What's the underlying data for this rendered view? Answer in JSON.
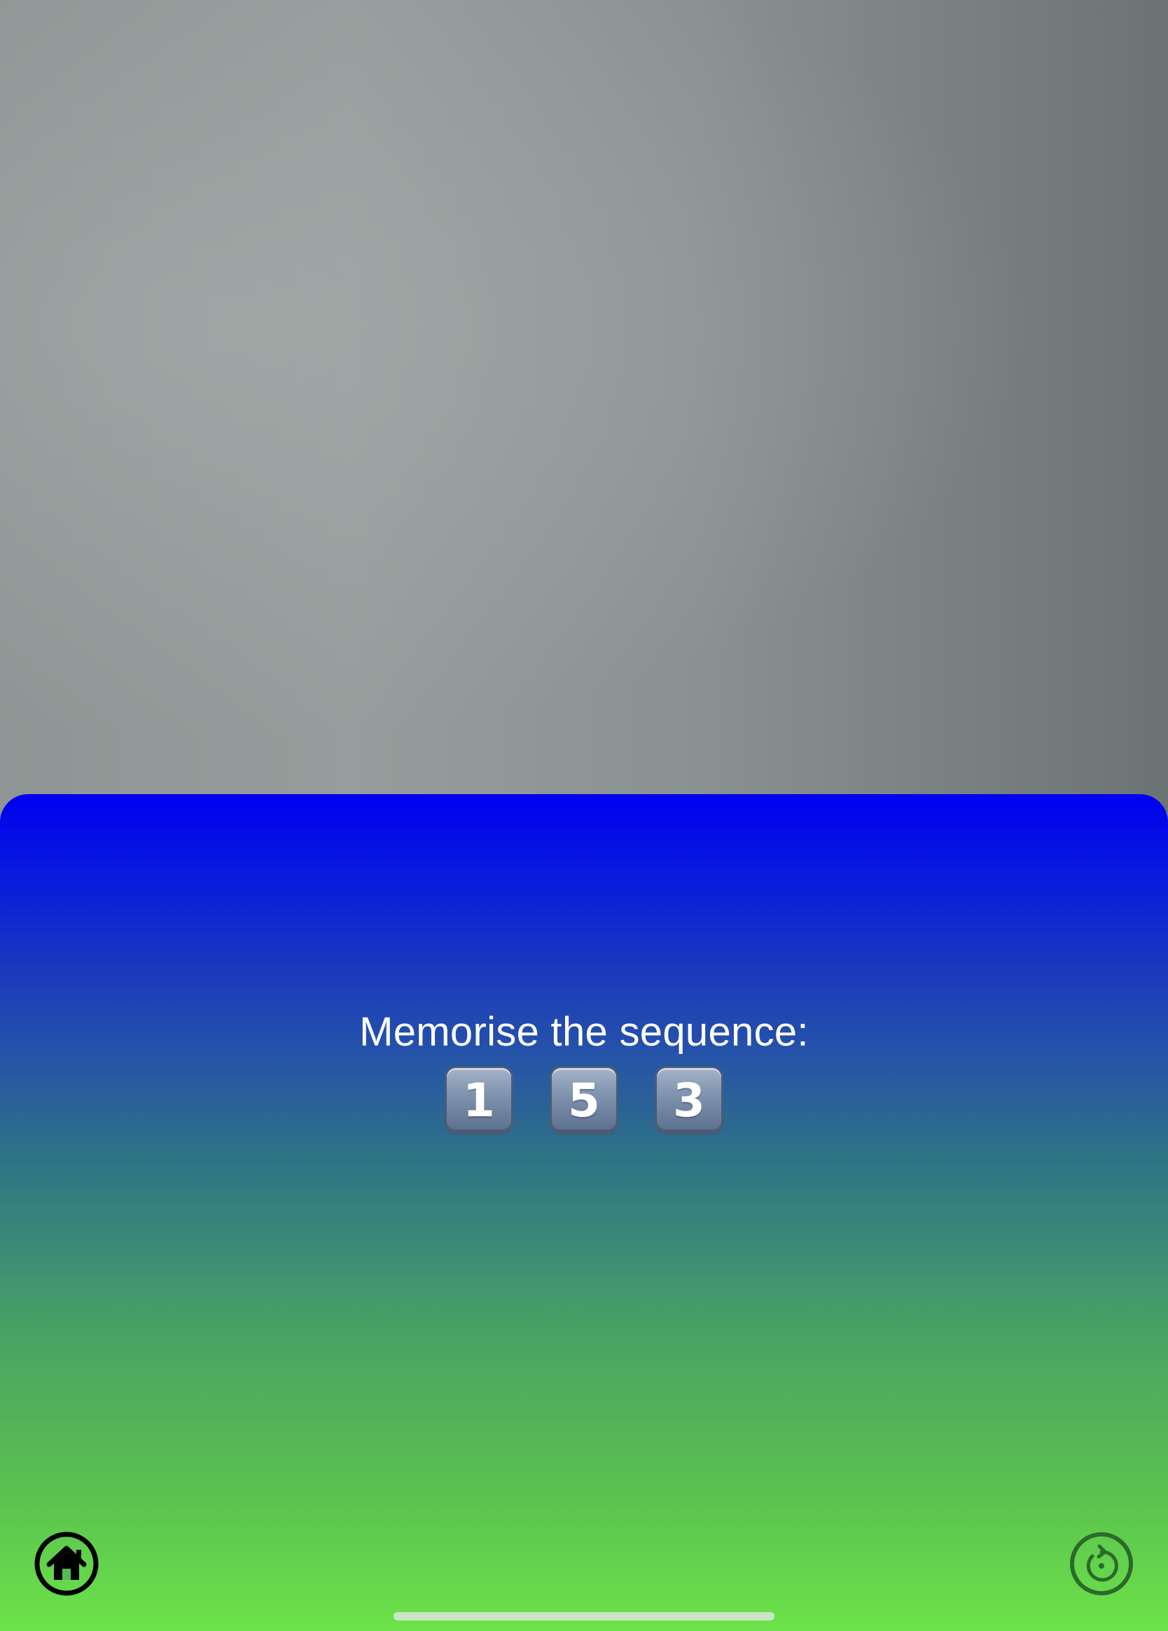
{
  "game": {
    "prompt": "Memorise the sequence:",
    "sequence": [
      "1",
      "5",
      "3"
    ]
  },
  "controls": {
    "home_icon": "home-icon",
    "restart_icon": "restart-icon"
  },
  "colors": {
    "panel_top": "#0000f0",
    "panel_bottom": "#6ce34a",
    "text": "#ffffff"
  }
}
